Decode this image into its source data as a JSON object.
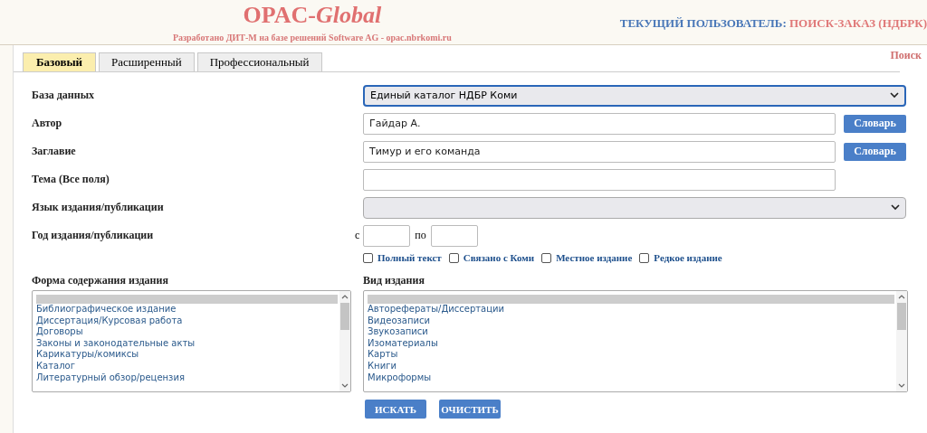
{
  "header": {
    "logo_prefix": "OPAC-",
    "logo_suffix": "Global",
    "subtitle": "Разработано ДИТ-М на базе решений Software AG - opac.nbrkomi.ru",
    "user_label": "ТЕКУЩИЙ ПОЛЬЗОВАТЕЛЬ:",
    "user_name": "ПОИСК-ЗАКАЗ (НДБРК)"
  },
  "tabs": [
    {
      "label": "Базовый",
      "selected": true
    },
    {
      "label": "Расширенный",
      "selected": false
    },
    {
      "label": "Профессиональный",
      "selected": false
    }
  ],
  "page_title": "Поиск",
  "fields": [
    {
      "kind": "select",
      "label": "База данных",
      "value": "Единый каталог НДБР Коми",
      "focused": true
    },
    {
      "kind": "text",
      "label": "Автор",
      "value": "Гайдар А.",
      "button": "Словарь"
    },
    {
      "kind": "text",
      "label": "Заглавие",
      "value": "Тимур и его команда",
      "button": "Словарь"
    },
    {
      "kind": "text",
      "label": "Тема (Все поля)"
    },
    {
      "kind": "select",
      "label": "Язык издания/публикации",
      "focused": false
    },
    {
      "kind": "range",
      "label": "Год издания/публикации",
      "from_label": "с",
      "to_label": "по"
    }
  ],
  "checkboxes": [
    {
      "label": "Полный текст",
      "checked": false
    },
    {
      "label": "Связано с Коми",
      "checked": false
    },
    {
      "label": "Местное издание",
      "checked": false
    },
    {
      "label": "Редкое издание",
      "checked": false
    }
  ],
  "lists": [
    {
      "label": "Форма содержания издания",
      "blank_selected": true,
      "items": [
        "Библиографическое издание",
        "Диссертация/Курсовая работа",
        "Договоры",
        "Законы и законодательные акты",
        "Карикатуры/комиксы",
        "Каталог",
        "Литературный обзор/рецензия"
      ]
    },
    {
      "label": "Вид издания",
      "blank_selected": true,
      "items": [
        "Авторефераты/Диссертации",
        "Видеозаписи",
        "Звукозаписи",
        "Изоматериалы",
        "Карты",
        "Книги",
        "Микроформы"
      ]
    }
  ],
  "buttons": [
    "ИСКАТЬ",
    "ОЧИСТИТЬ"
  ]
}
